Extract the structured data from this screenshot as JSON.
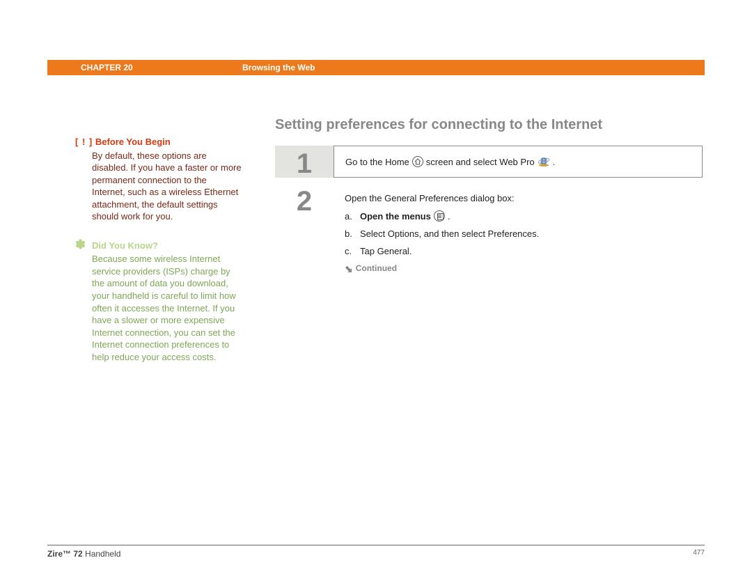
{
  "header": {
    "chapter_label": "CHAPTER 20",
    "chapter_title": "Browsing the Web"
  },
  "sidebar": {
    "before_begin": {
      "prefix": "[ ! ]",
      "heading": "Before You Begin",
      "body": "By default, these options are disabled. If you have a faster or more permanent connection to the Internet, such as a wireless Ethernet attachment, the default settings should work for you."
    },
    "did_you_know": {
      "icon": "✽",
      "heading": "Did You Know?",
      "body": "Because some wireless Internet service providers (ISPs) charge by the amount of data you download, your handheld is careful to limit how often it accesses the Internet. If you have a slower or more expensive Internet connection, you can set the Internet connection preferences to help reduce your access costs."
    }
  },
  "main": {
    "heading": "Setting preferences for connecting to the Internet",
    "step1": {
      "num": "1",
      "text_before": "Go to the Home",
      "text_mid": "screen and select Web Pro",
      "text_after": "."
    },
    "step2": {
      "num": "2",
      "intro": "Open the General Preferences dialog box:",
      "a_letter": "a.",
      "a_bold": "Open the menus",
      "a_after": ".",
      "b_letter": "b.",
      "b_text": "Select Options, and then select Preferences.",
      "c_letter": "c.",
      "c_text": "Tap General.",
      "continued": "Continued"
    }
  },
  "footer": {
    "product_bold": "Zire™ 72",
    "product_rest": " Handheld",
    "page": "477"
  }
}
